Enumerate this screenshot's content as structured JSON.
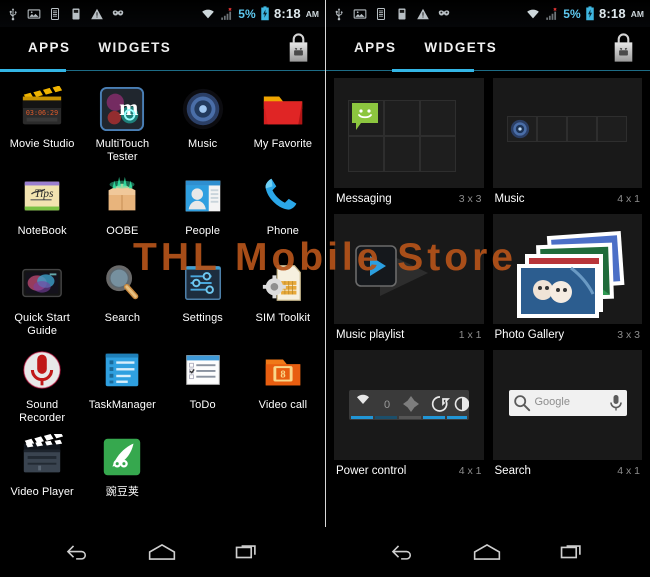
{
  "watermark": "THL  Mobile  Store",
  "colors": {
    "accent": "#33b5e5",
    "background": "#000000",
    "label": "#ffffff",
    "watermark": "#b4531a",
    "battery_pct": "#5ec8ef",
    "widget_size_text": "#8d8d8d"
  },
  "status_bar": {
    "left_icons": [
      "usb-icon",
      "image-icon",
      "sim-card-1-icon",
      "sim-card-2-icon",
      "warning-icon",
      "mask-icon"
    ],
    "wifi_icon": "wifi-icon",
    "signal_icon": "signal-no-service-icon",
    "battery_percent": "5%",
    "battery_icon": "battery-charging-icon",
    "time": "8:18",
    "ampm": "AM"
  },
  "panels": [
    {
      "id": "left",
      "tabs": [
        {
          "label": "APPS",
          "active": true
        },
        {
          "label": "WIDGETS",
          "active": false
        }
      ],
      "store_button": "play-store-bag-icon",
      "apps": [
        {
          "label": "Movie Studio",
          "icon": "movie-studio-icon"
        },
        {
          "label": "MultiTouch Tester",
          "icon": "multitouch-tester-icon"
        },
        {
          "label": "Music",
          "icon": "music-icon"
        },
        {
          "label": "My Favorite",
          "icon": "my-favorite-icon"
        },
        {
          "label": "NoteBook",
          "icon": "notebook-icon"
        },
        {
          "label": "OOBE",
          "icon": "oobe-icon"
        },
        {
          "label": "People",
          "icon": "people-icon"
        },
        {
          "label": "Phone",
          "icon": "phone-icon"
        },
        {
          "label": "Quick Start Guide",
          "icon": "quick-start-guide-icon"
        },
        {
          "label": "Search",
          "icon": "search-icon"
        },
        {
          "label": "Settings",
          "icon": "settings-icon"
        },
        {
          "label": "SIM Toolkit",
          "icon": "sim-toolkit-icon"
        },
        {
          "label": "Sound Recorder",
          "icon": "sound-recorder-icon"
        },
        {
          "label": "TaskManager",
          "icon": "taskmanager-icon"
        },
        {
          "label": "ToDo",
          "icon": "todo-icon"
        },
        {
          "label": "Video call",
          "icon": "video-call-icon"
        },
        {
          "label": "Video Player",
          "icon": "video-player-icon"
        },
        {
          "label": "豌豆荚",
          "icon": "wandoujia-icon"
        }
      ]
    },
    {
      "id": "right",
      "tabs": [
        {
          "label": "APPS",
          "active": false
        },
        {
          "label": "WIDGETS",
          "active": true
        }
      ],
      "store_button": "play-store-bag-icon",
      "widgets": [
        {
          "name": "Messaging",
          "size": "3 x 3",
          "preview": "messaging-widget-preview"
        },
        {
          "name": "Music",
          "size": "4 x 1",
          "preview": "music-widget-preview"
        },
        {
          "name": "Music playlist",
          "size": "1 x 1",
          "preview": "music-playlist-widget-preview"
        },
        {
          "name": "Photo Gallery",
          "size": "3 x 3",
          "preview": "photo-gallery-widget-preview"
        },
        {
          "name": "Power control",
          "size": "4 x 1",
          "preview": "power-control-widget-preview"
        },
        {
          "name": "Search",
          "size": "4 x 1",
          "preview": "search-widget-preview"
        }
      ],
      "power_control_toggles": [
        "wifi-toggle-icon",
        "bluetooth-toggle-icon",
        "gps-toggle-icon",
        "sync-toggle-icon",
        "brightness-toggle-icon"
      ],
      "search_widget": {
        "placeholder": "Google",
        "search_icon": "magnifier-icon",
        "voice_icon": "microphone-icon"
      }
    }
  ],
  "nav_bar": {
    "buttons": [
      "back-button",
      "home-button",
      "recents-button"
    ]
  }
}
